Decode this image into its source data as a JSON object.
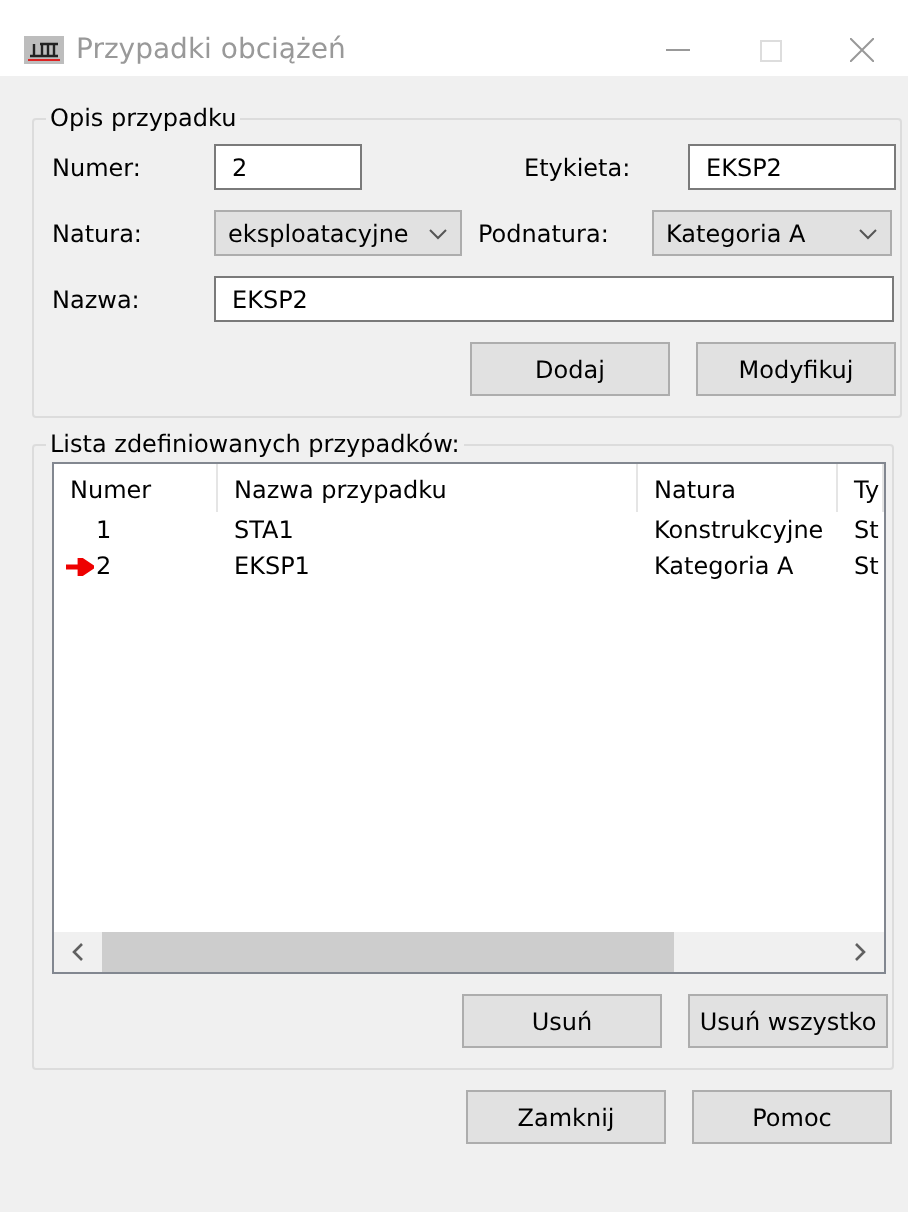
{
  "window": {
    "title": "Przypadki obciążeń"
  },
  "case_description": {
    "title": "Opis przypadku",
    "number_label": "Numer:",
    "number": "2",
    "tag_label": "Etykieta:",
    "tag": "EKSP2",
    "nature_label": "Natura:",
    "nature": "eksploatacyjne",
    "subnature_label": "Podnatura:",
    "subnature": "Kategoria A",
    "name_label": "Nazwa:",
    "name": "EKSP2",
    "buttons": [
      "Dodaj",
      "Modyfikuj"
    ]
  },
  "case_list": {
    "title": "Lista zdefiniowanych przypadków:",
    "columns": [
      "Numer",
      "Nazwa przypadku",
      "Natura",
      "Ty"
    ],
    "rows": [
      {
        "cells": [
          "1",
          "STA1",
          "Konstrukcyjne",
          "St"
        ],
        "current": false
      },
      {
        "cells": [
          "2",
          "EKSP1",
          "Kategoria A",
          "St"
        ],
        "current": true
      }
    ],
    "buttons": [
      "Usuń",
      "Usuń wszystko"
    ]
  },
  "buttons": [
    "Zamknij",
    "Pomoc"
  ]
}
